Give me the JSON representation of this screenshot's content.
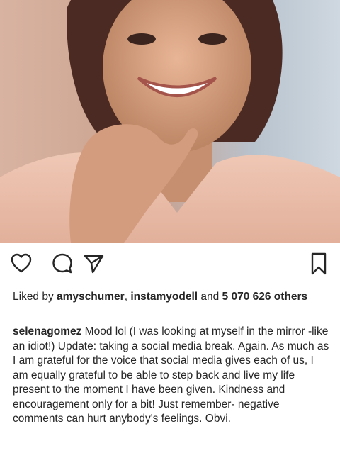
{
  "post": {
    "likes": {
      "prefix": "Liked by ",
      "user1": "amyschumer",
      "separator": ", ",
      "user2": "instamyodell",
      "and_text": " and ",
      "others": "5 070 626 others"
    },
    "caption": {
      "username": "selenagomez",
      "text": "Mood lol (I was looking at myself in the mirror -like an idiot!) Update: taking a social media break. Again. As much as I am grateful for the voice that social media gives each of us, I am equally grateful to be able to step back and live my life present to the moment I have been given. Kindness and encouragement only for a bit! Just remember- negative comments can hurt anybody's feelings. Obvi."
    },
    "icons": {
      "like": "heart-icon",
      "comment": "comment-icon",
      "share": "paper-plane-icon",
      "save": "bookmark-icon"
    }
  }
}
